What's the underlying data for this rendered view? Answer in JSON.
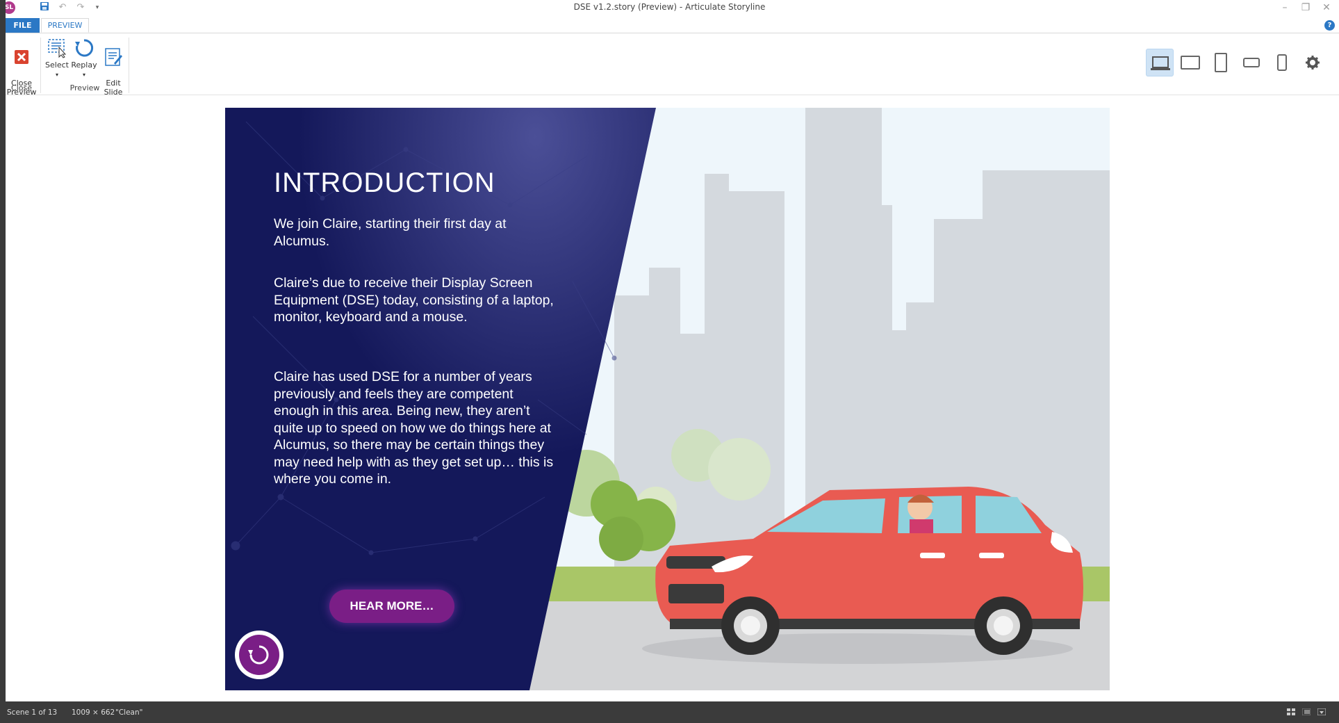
{
  "window": {
    "title": "DSE v1.2.story (Preview) -  Articulate Storyline",
    "app_icon": "SL"
  },
  "quick_access": {
    "icons": [
      "save-icon",
      "undo-icon",
      "redo-icon",
      "customize-dropdown-icon"
    ]
  },
  "tabs": {
    "file": "FILE",
    "preview": "PREVIEW"
  },
  "ribbon": {
    "close_preview": "Close\nPreview",
    "close_group": "Close",
    "select": "Select",
    "replay": "Replay",
    "edit_slide": "Edit\nSlide",
    "preview_group": "Preview",
    "devices": [
      "laptop-icon",
      "tablet-landscape-icon",
      "tablet-portrait-icon",
      "phone-landscape-icon",
      "phone-portrait-icon"
    ],
    "settings_icon": "gear-icon"
  },
  "slide": {
    "title": "INTRODUCTION",
    "para1": "We join Claire, starting their first day at Alcumus.",
    "para2": "Claire’s due to receive their Display Screen Equipment (DSE) today, consisting of a laptop, monitor, keyboard and a mouse.",
    "para3": "Claire has used DSE for a number of years previously and feels they are competent enough in this area. Being new, they aren’t quite up to speed on how we do things here at Alcumus, so there may be certain things they may need help with as they get set up… this is where you come in.",
    "button": "HEAR MORE…",
    "colors": {
      "panel": "#1a1f66",
      "accent": "#7a1e86",
      "car": "#e95b52",
      "grass": "#a9c667",
      "sky": "#eef6fb",
      "buildings": "#d4d9de"
    }
  },
  "status": {
    "scene": "Scene 1 of 13",
    "dimensions": "1009 × 662",
    "theme": "\"Clean\""
  }
}
